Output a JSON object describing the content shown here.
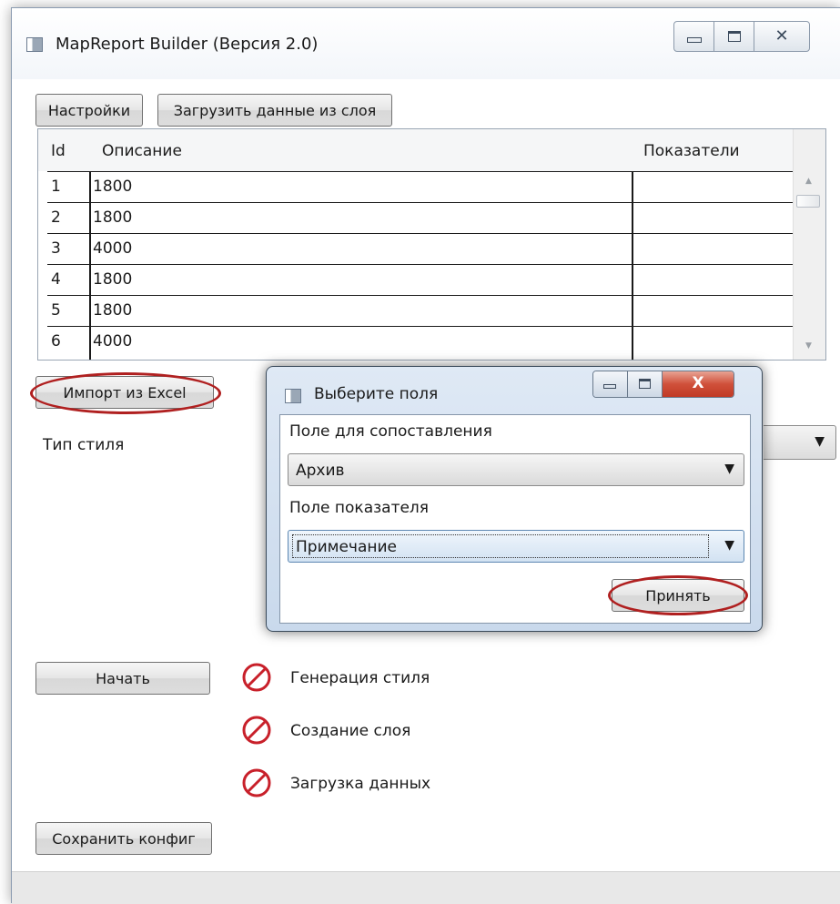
{
  "window": {
    "title": "MapReport Builder (Версия 2.0)",
    "controls": {
      "minimize_glyph": "▭",
      "maximize_glyph": "▣",
      "close_glyph": "✕"
    }
  },
  "toolbar": {
    "settings_label": "Настройки",
    "load_layer_label": "Загрузить данные из слоя"
  },
  "grid": {
    "columns": [
      "Id",
      "Описание",
      "Показатели"
    ],
    "rows": [
      {
        "id": "1",
        "description": "1800",
        "indicators": ""
      },
      {
        "id": "2",
        "description": "1800",
        "indicators": ""
      },
      {
        "id": "3",
        "description": "4000",
        "indicators": ""
      },
      {
        "id": "4",
        "description": "1800",
        "indicators": ""
      },
      {
        "id": "5",
        "description": "1800",
        "indicators": ""
      },
      {
        "id": "6",
        "description": "4000",
        "indicators": ""
      }
    ]
  },
  "import_excel_label": "Импорт из Excel",
  "style_type_label": "Тип стиля",
  "start_label": "Начать",
  "steps": [
    {
      "label": "Генерация стиля",
      "icon": "blocked-icon"
    },
    {
      "label": "Создание слоя",
      "icon": "blocked-icon"
    },
    {
      "label": "Загрузка данных",
      "icon": "blocked-icon"
    }
  ],
  "save_config_label": "Сохранить конфиг",
  "dialog": {
    "title": "Выберите поля",
    "match_field_label": "Поле для сопоставления",
    "match_field_value": "Архив",
    "indicator_field_label": "Поле показателя",
    "indicator_field_value": "Примечание",
    "accept_label": "Принять",
    "close_glyph": "X"
  },
  "colors": {
    "highlight_ellipse": "#b02020",
    "blocked_icon": "#c8202a",
    "dialog_close": "#c03a25"
  }
}
